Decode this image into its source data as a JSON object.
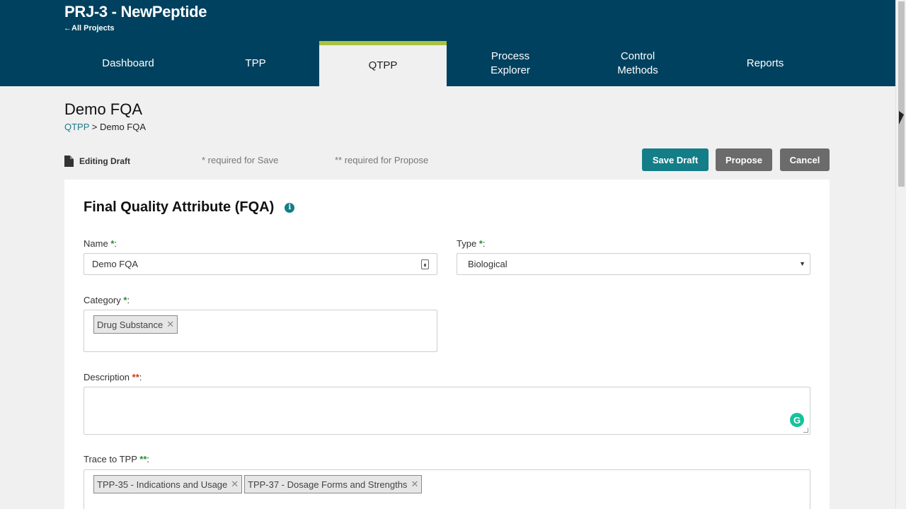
{
  "header": {
    "project_title": "PRJ-3 - NewPeptide",
    "back_link": "←All Projects",
    "tabs": [
      {
        "label": "Dashboard"
      },
      {
        "label": "TPP"
      },
      {
        "label": "QTPP"
      },
      {
        "label": "Process\nExplorer"
      },
      {
        "label": "Control\nMethods"
      },
      {
        "label": "Reports"
      }
    ],
    "active_tab": "QTPP"
  },
  "page": {
    "title": "Demo FQA",
    "breadcrumb_link": "QTPP",
    "breadcrumb_sep": ">",
    "breadcrumb_current": "Demo FQA"
  },
  "toolbar": {
    "status": "Editing Draft",
    "required_save_note": "* required for Save",
    "required_propose_note": "** required for Propose",
    "save_draft_label": "Save Draft",
    "propose_label": "Propose",
    "cancel_label": "Cancel"
  },
  "form": {
    "heading": "Final Quality Attribute (FQA)",
    "name_label": "Name",
    "name_value": "Demo FQA",
    "type_label": "Type",
    "type_value": "Biological",
    "category_label": "Category",
    "category_tags": [
      "Drug Substance"
    ],
    "description_label": "Description",
    "description_value": "",
    "trace_label": "Trace to TPP",
    "trace_tags": [
      "TPP-35 - Indications and Usage",
      "TPP-37 - Dosage Forms and Strengths"
    ],
    "single_req": "*",
    "double_req": "**"
  },
  "colors": {
    "header_bg": "#00415f",
    "active_tab_accent": "#a9c23f",
    "primary_button": "#137e88",
    "secondary_button": "#6b6b6b"
  }
}
